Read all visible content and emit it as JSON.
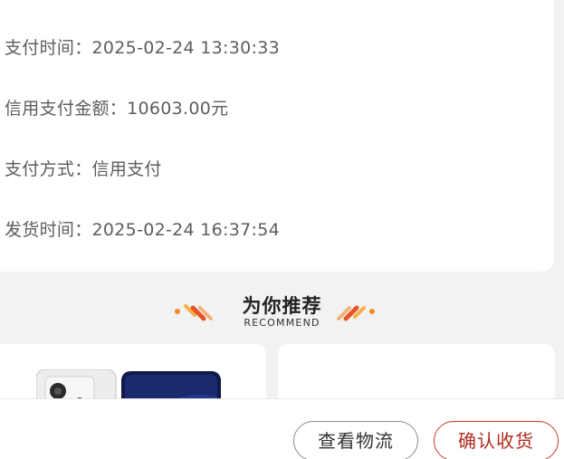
{
  "order_info": {
    "rows": [
      {
        "label": "支付时间：",
        "value": "2025-02-24 13:30:33"
      },
      {
        "label": "信用支付金额：",
        "value": "10603.00元"
      },
      {
        "label": "支付方式：",
        "value": "信用支付"
      },
      {
        "label": "发货时间：",
        "value": "2025-02-24 16:37:54"
      }
    ]
  },
  "recommend": {
    "title": "为你推荐",
    "subtitle": "RECOMMEND",
    "accent_colors": [
      "#f28a2a",
      "#e6542a"
    ]
  },
  "products": [
    {
      "image": "phone-image"
    },
    {
      "image": "product-image"
    }
  ],
  "actions": {
    "view_logistics": "查看物流",
    "confirm_receipt": "确认收货"
  },
  "colors": {
    "primary_action": "#b22b1f",
    "secondary_action": "#8a8a8a"
  }
}
